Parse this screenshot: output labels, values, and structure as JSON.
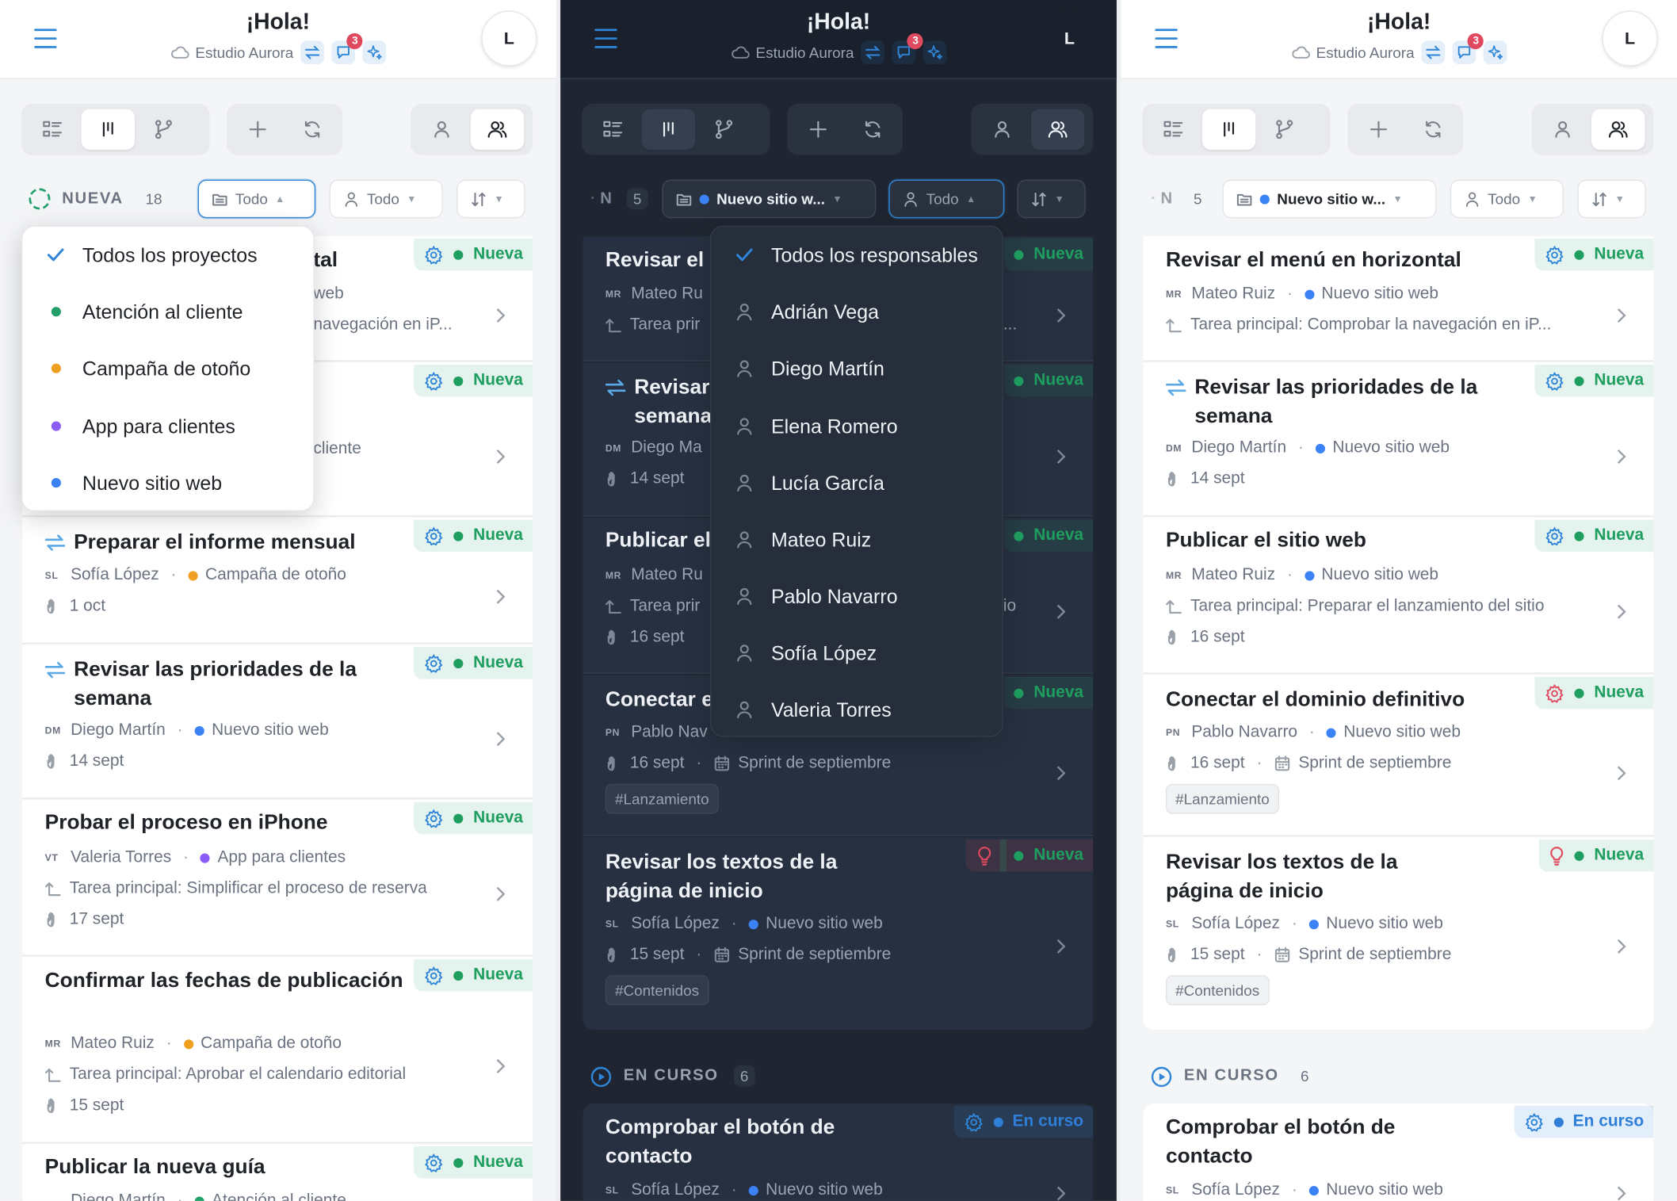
{
  "colors": {
    "accent": "#2f86d8",
    "status_new": "#1e9e5f",
    "status_progress": "#2f7fd8",
    "notification": "#e04a5f",
    "project_atencion": "#22a06b",
    "project_campana": "#f0a020",
    "project_app": "#8b5cf6",
    "project_web": "#3b82f6"
  },
  "header": {
    "title": "¡Hola!",
    "workspace": "Estudio Aurora",
    "notifications": "3",
    "avatar_initial": "L"
  },
  "filters": {
    "col_title": "NUEVA",
    "count_all": "18",
    "count_filtered": "5",
    "all_label": "Todo",
    "project_selected": "Nuevo sitio w...",
    "collapsed_letter": "N"
  },
  "project_dropdown": {
    "items": [
      {
        "label": "Todos los proyectos",
        "color": ""
      },
      {
        "label": "Atención al cliente",
        "color": "#22a06b"
      },
      {
        "label": "Campaña de otoño",
        "color": "#f0a020"
      },
      {
        "label": "App para clientes",
        "color": "#8b5cf6"
      },
      {
        "label": "Nuevo sitio web",
        "color": "#3b82f6"
      }
    ]
  },
  "assignee_dropdown": {
    "items": [
      "Todos los responsables",
      "Adrián Vega",
      "Diego Martín",
      "Elena Romero",
      "Lucía García",
      "Mateo Ruiz",
      "Pablo Navarro",
      "Sofía López",
      "Valeria Torres"
    ]
  },
  "status": {
    "new": "Nueva",
    "in_progress": "En curso"
  },
  "sections": {
    "in_progress": {
      "title": "EN CURSO",
      "count": "6"
    }
  },
  "left_cards": [
    {
      "title": "Revisar el menú en horizontal",
      "visible_title": "tal",
      "line1": "web",
      "line2": "navegación en iP..."
    },
    {
      "line1": "cliente"
    },
    {
      "title": "Preparar el informe mensual",
      "initials": "SL",
      "person": "Sofía López",
      "project": "Campaña de otoño",
      "date": "1 oct"
    },
    {
      "title": "Revisar las prioridades de la semana",
      "initials": "DM",
      "person": "Diego Martín",
      "project": "Nuevo sitio web",
      "date": "14 sept"
    },
    {
      "title": "Probar el proceso en iPhone",
      "initials": "VT",
      "person": "Valeria Torres",
      "project": "App para clientes",
      "parent": "Tarea principal: Simplificar el proceso de reserva",
      "date": "17 sept"
    },
    {
      "title": "Confirmar las fechas de publicación",
      "initials": "MR",
      "person": "Mateo Ruiz",
      "project": "Campaña de otoño",
      "parent": "Tarea principal: Aprobar el calendario editorial",
      "date": "15 sept"
    },
    {
      "title": "Publicar la nueva guía",
      "person": "Diego Martín",
      "project": "Atención al cliente"
    }
  ],
  "web_cards": [
    {
      "title": "Revisar el menú en horizontal",
      "initials": "MR",
      "person": "Mateo Ruiz",
      "project": "Nuevo sitio web",
      "parent": "Tarea principal: Comprobar la navegación en iP..."
    },
    {
      "title": "Revisar las prioridades de la semana",
      "initials": "DM",
      "person": "Diego Martín",
      "project": "Nuevo sitio web",
      "date": "14 sept"
    },
    {
      "title": "Publicar el sitio web",
      "initials": "MR",
      "person": "Mateo Ruiz",
      "project": "Nuevo sitio web",
      "parent": "Tarea principal: Preparar el lanzamiento del sitio",
      "date": "16 sept"
    },
    {
      "title": "Conectar el dominio definitivo",
      "initials": "PN",
      "person": "Pablo Navarro",
      "project": "Nuevo sitio web",
      "date": "16 sept",
      "sprint": "Sprint de septiembre",
      "tag": "#Lanzamiento"
    },
    {
      "title": "Revisar los textos de la página de inicio",
      "initials": "SL",
      "person": "Sofía López",
      "project": "Nuevo sitio web",
      "date": "15 sept",
      "sprint": "Sprint de septiembre",
      "tag": "#Contenidos"
    }
  ],
  "dark_partial": {
    "t1": "Revisar el",
    "m1": "Mateo Ru",
    "p1": "Tarea prir",
    "p1_tail": "...",
    "t2": "Revisar",
    "t2b": "semana",
    "m2": "Diego Ma",
    "t3": "Publicar el",
    "m3": "Mateo Ru",
    "p3": "Tarea prir",
    "p3_tail": "io",
    "t4": "Conectar e",
    "m4": "Pablo Nav"
  },
  "progress_card": {
    "title": "Comprobar el botón de contacto",
    "initials": "SL",
    "person": "Sofía López",
    "project": "Nuevo sitio web"
  }
}
